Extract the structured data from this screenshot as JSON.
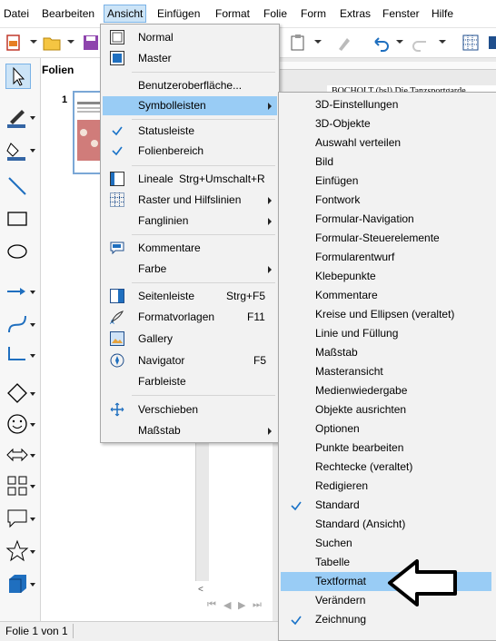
{
  "menubar": {
    "items": [
      "Datei",
      "Bearbeiten",
      "Ansicht",
      "Einfügen",
      "Format",
      "Folie",
      "Form",
      "Extras",
      "Fenster",
      "Hilfe"
    ],
    "active": "Ansicht"
  },
  "slide_panel": {
    "title": "Folien",
    "slide_number": "1"
  },
  "statusbar": {
    "slide_info": "Folie 1 von 1"
  },
  "document_peek": {
    "header_text": "BOCHOLT (bsl) Die Tanzsportgarde"
  },
  "ansicht_menu": {
    "items": [
      {
        "label": "Normal",
        "icon": "normal-view-icon"
      },
      {
        "label": "Master",
        "icon": "master-view-icon"
      },
      {
        "label": "Benutzeroberfläche..."
      },
      {
        "label": "Symbolleisten",
        "submenu": true,
        "highlighted": true
      },
      {
        "label": "Statusleiste",
        "checked": true
      },
      {
        "label": "Folienbereich",
        "checked": true
      },
      {
        "label": "Lineale",
        "shortcut": "Strg+Umschalt+R",
        "icon": "ruler-icon"
      },
      {
        "label": "Raster und Hilfslinien",
        "submenu": true,
        "icon": "grid-icon"
      },
      {
        "label": "Fanglinien",
        "submenu": true
      },
      {
        "label": "Kommentare",
        "icon": "comment-icon"
      },
      {
        "label": "Farbe",
        "submenu": true
      },
      {
        "label": "Seitenleiste",
        "shortcut": "Strg+F5",
        "icon": "sidebar-icon"
      },
      {
        "label": "Formatvorlagen",
        "shortcut": "F11",
        "icon": "styles-icon"
      },
      {
        "label": "Gallery",
        "icon": "gallery-icon"
      },
      {
        "label": "Navigator",
        "shortcut": "F5",
        "icon": "navigator-icon"
      },
      {
        "label": "Farbleiste"
      },
      {
        "label": "Verschieben",
        "icon": "move-icon"
      },
      {
        "label": "Maßstab",
        "submenu": true
      }
    ]
  },
  "symbolleisten_menu": {
    "items": [
      {
        "label": "3D-Einstellungen"
      },
      {
        "label": "3D-Objekte"
      },
      {
        "label": "Auswahl verteilen"
      },
      {
        "label": "Bild"
      },
      {
        "label": "Einfügen"
      },
      {
        "label": "Fontwork"
      },
      {
        "label": "Formular-Navigation"
      },
      {
        "label": "Formular-Steuerelemente"
      },
      {
        "label": "Formularentwurf"
      },
      {
        "label": "Klebepunkte"
      },
      {
        "label": "Kommentare"
      },
      {
        "label": "Kreise und Ellipsen (veraltet)"
      },
      {
        "label": "Linie und Füllung"
      },
      {
        "label": "Maßstab"
      },
      {
        "label": "Masteransicht"
      },
      {
        "label": "Medienwiedergabe"
      },
      {
        "label": "Objekte ausrichten"
      },
      {
        "label": "Optionen"
      },
      {
        "label": "Punkte bearbeiten"
      },
      {
        "label": "Rechtecke (veraltet)"
      },
      {
        "label": "Redigieren"
      },
      {
        "label": "Standard",
        "checked": true
      },
      {
        "label": "Standard (Ansicht)"
      },
      {
        "label": "Suchen"
      },
      {
        "label": "Tabelle"
      },
      {
        "label": "Textformat",
        "highlighted": true
      },
      {
        "label": "Verändern"
      },
      {
        "label": "Zeichnung",
        "checked": true
      }
    ]
  },
  "colors": {
    "highlight": "#99ccf5",
    "check": "#1a73c8",
    "menu_bg": "#f2f2f2"
  }
}
